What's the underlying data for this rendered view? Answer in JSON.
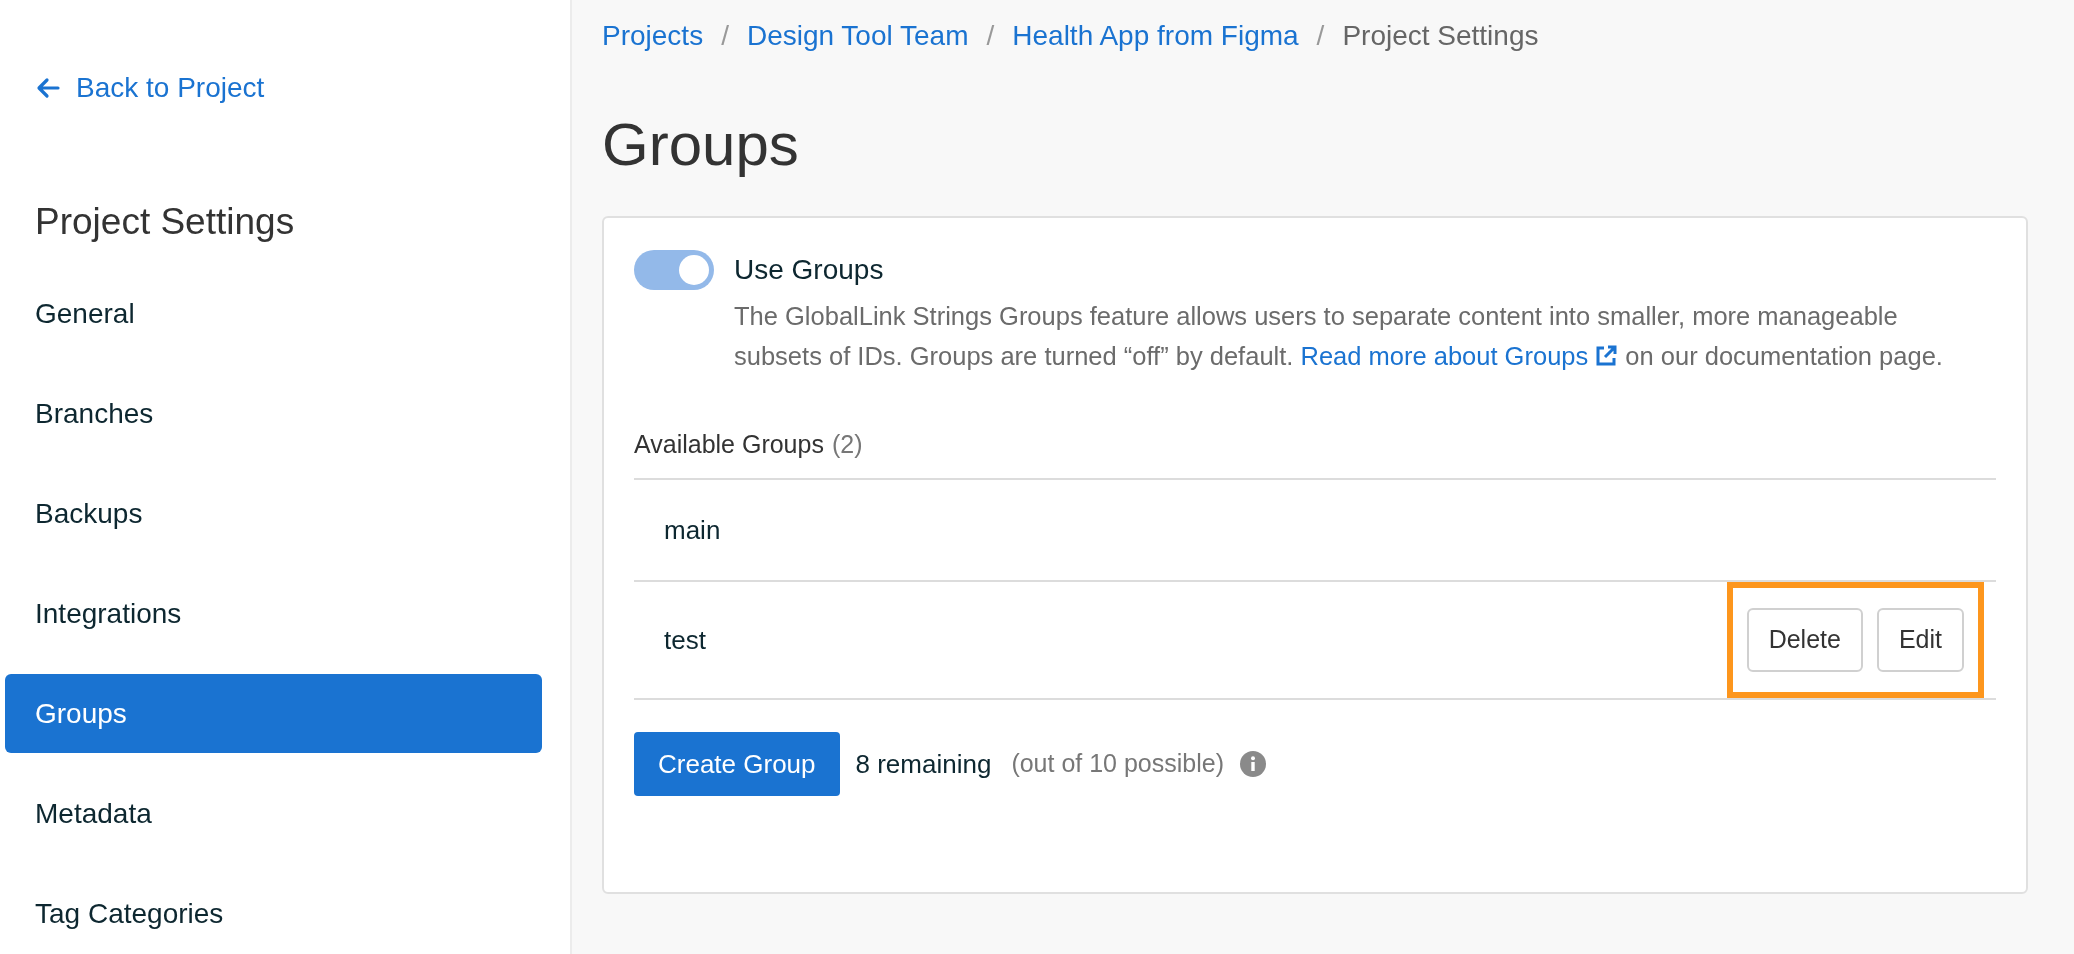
{
  "sidebar": {
    "back_link": "Back to Project",
    "title": "Project Settings",
    "items": [
      {
        "label": "General",
        "selected": false
      },
      {
        "label": "Branches",
        "selected": false
      },
      {
        "label": "Backups",
        "selected": false
      },
      {
        "label": "Integrations",
        "selected": false
      },
      {
        "label": "Groups",
        "selected": true
      },
      {
        "label": "Metadata",
        "selected": false
      },
      {
        "label": "Tag Categories",
        "selected": false
      }
    ]
  },
  "breadcrumb": {
    "links": [
      "Projects",
      "Design Tool Team",
      "Health App from Figma"
    ],
    "separator": "/",
    "current": "Project Settings"
  },
  "page_title": "Groups",
  "card": {
    "toggle": {
      "label": "Use Groups",
      "on": true
    },
    "description": {
      "before": "The GlobalLink Strings Groups feature allows users to separate content into smaller, more manageable subsets of IDs. Groups are turned “off” by default.",
      "link": "Read more about Groups",
      "after": "on our documentation page."
    },
    "list_title": "Available Groups",
    "list_count": "(2)",
    "groups": [
      {
        "name": "main"
      },
      {
        "name": "test",
        "actions": [
          "Delete",
          "Edit"
        ],
        "highlighted": true
      }
    ],
    "create_button": "Create Group",
    "remaining": "8 remaining",
    "possible": "(out of 10 possible)"
  }
}
